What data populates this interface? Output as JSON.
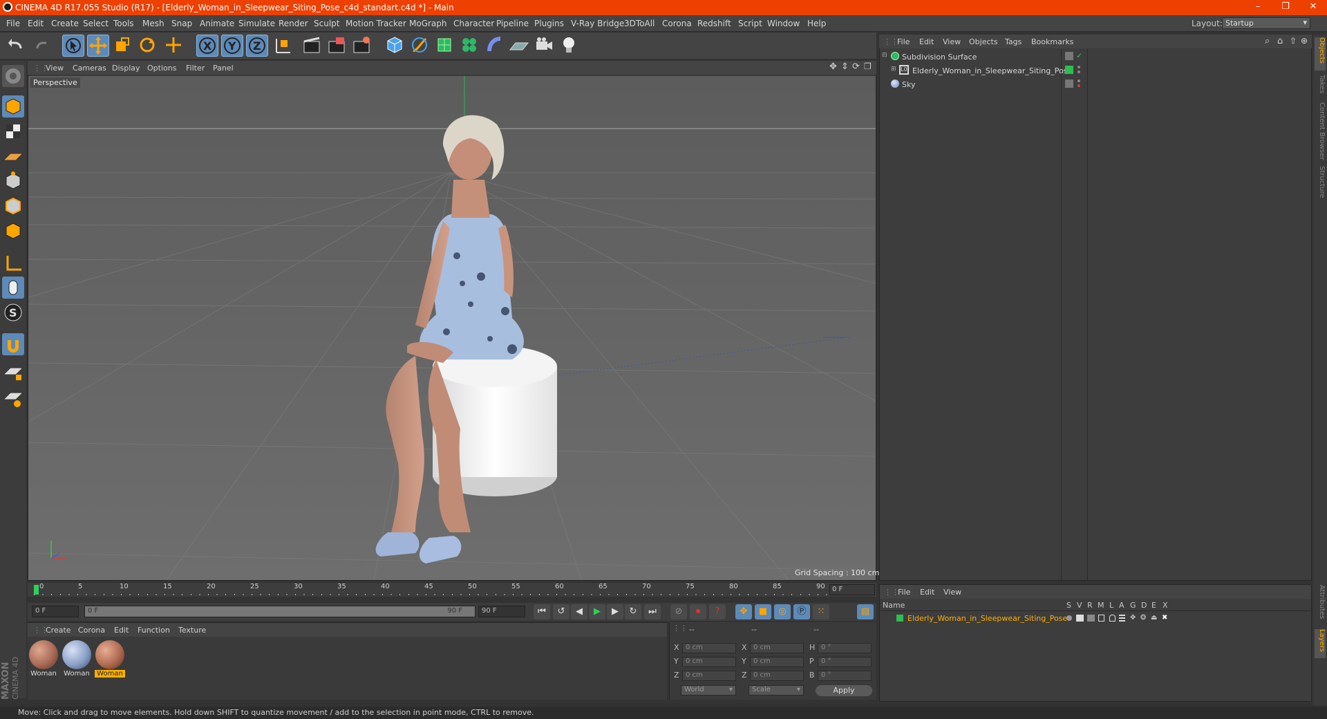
{
  "window": {
    "title": "CINEMA 4D R17.055 Studio (R17) - [Elderly_Woman_in_Sleepwear_Siting_Pose_c4d_standart.c4d *] - Main",
    "controls": [
      "–",
      "❐",
      "✕"
    ]
  },
  "menubar": {
    "items": [
      "File",
      "Edit",
      "Create",
      "Select",
      "Tools",
      "Mesh",
      "Snap",
      "Animate",
      "Simulate",
      "Render",
      "Sculpt",
      "Motion Tracker",
      "MoGraph",
      "Character",
      "Pipeline",
      "Plugins",
      "V-Ray Bridge",
      "3DToAll",
      "Corona",
      "Redshift",
      "Script",
      "Window",
      "Help"
    ],
    "layout_label": "Layout:",
    "layout_value": "Startup"
  },
  "viewport": {
    "menu": [
      "View",
      "Cameras",
      "Display",
      "Options",
      "Filter",
      "Panel"
    ],
    "camera_label": "Perspective",
    "grid_spacing": "Grid Spacing : 100 cm"
  },
  "timeline": {
    "ticks": [
      "0",
      "5",
      "10",
      "15",
      "20",
      "25",
      "30",
      "35",
      "40",
      "45",
      "50",
      "55",
      "60",
      "65",
      "70",
      "75",
      "80",
      "85",
      "90"
    ],
    "current_frame": "0 F",
    "start_frame": "0 F",
    "range_start": "0 F",
    "range_end": "90 F",
    "end_frame": "90 F"
  },
  "materials": {
    "menu": [
      "Create",
      "Corona",
      "Edit",
      "Function",
      "Texture"
    ],
    "items": [
      {
        "label": "Woman",
        "selected": false,
        "color": "#a86a55"
      },
      {
        "label": "Woman",
        "selected": false,
        "color": "#8aa0c8"
      },
      {
        "label": "Woman",
        "selected": true,
        "color": "#b06a50"
      }
    ]
  },
  "coordinates": {
    "header": [
      "--",
      "--",
      "--"
    ],
    "rows": [
      {
        "l1": "X",
        "v1": "0 cm",
        "l2": "X",
        "v2": "0 cm",
        "l3": "H",
        "v3": "0 °"
      },
      {
        "l1": "Y",
        "v1": "0 cm",
        "l2": "Y",
        "v2": "0 cm",
        "l3": "P",
        "v3": "0 °"
      },
      {
        "l1": "Z",
        "v1": "0 cm",
        "l2": "Z",
        "v2": "0 cm",
        "l3": "B",
        "v3": "0 °"
      }
    ],
    "space": "World",
    "mode": "Scale",
    "apply": "Apply"
  },
  "objects": {
    "menu": [
      "File",
      "Edit",
      "View",
      "Objects",
      "Tags",
      "Bookmarks"
    ],
    "rows": [
      {
        "name": "Subdivision Surface",
        "icon": "subdivision-icon"
      },
      {
        "name": "Elderly_Woman_in_Sleepwear_Siting_Pose",
        "icon": "null-object-icon"
      },
      {
        "name": "Sky",
        "icon": "sky-icon"
      }
    ]
  },
  "layers": {
    "menu": [
      "File",
      "Edit",
      "View"
    ],
    "columns": [
      "Name",
      "S",
      "V",
      "R",
      "M",
      "L",
      "A",
      "G",
      "D",
      "E",
      "X"
    ],
    "rows": [
      {
        "name": "Elderly_Woman_in_Sleepwear_Siting_Pose",
        "color": "#2ebd50"
      }
    ]
  },
  "right_tabs": [
    "Objects",
    "Takes",
    "Content Browser",
    "Structure",
    "Attributes",
    "Layers"
  ],
  "status": {
    "text": "Move: Click and drag to move elements. Hold down SHIFT to quantize movement / add to the selection in point mode, CTRL to remove."
  },
  "brand": {
    "line1": "MAXON",
    "line2": "CINEMA 4D"
  },
  "colors": {
    "accent": "#ee4000",
    "selection": "#5d8ab8",
    "highlight": "#ffb000"
  }
}
